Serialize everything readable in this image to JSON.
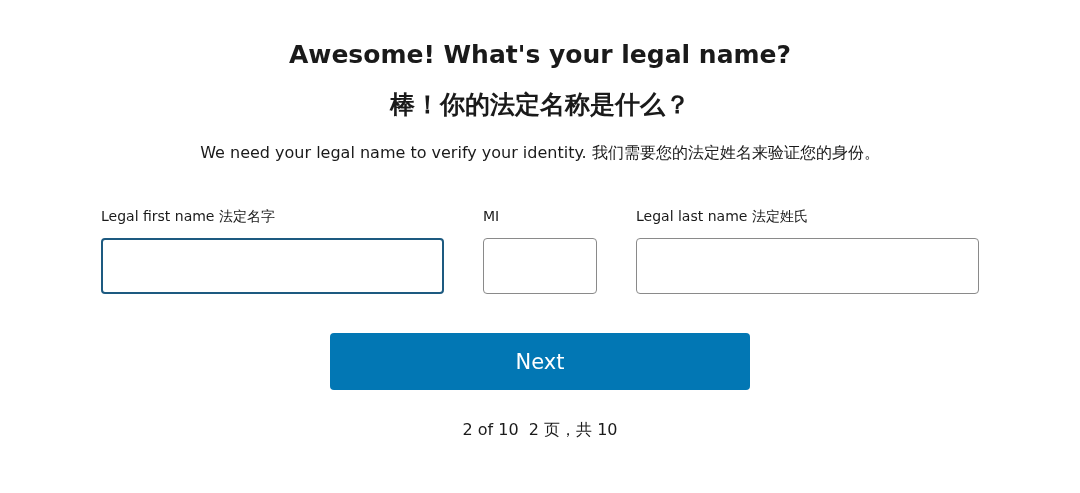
{
  "heading": "Awesome! What's your legal name?",
  "heading_translation": "棒！你的法定名称是什么？",
  "description": "We need your legal name to verify your identity. 我们需要您的法定姓名来验证您的身份。",
  "fields": [
    {
      "label": "Legal first name 法定名字",
      "kind": "name",
      "focused": true
    },
    {
      "label": "MI",
      "kind": "initial",
      "focused": false
    },
    {
      "label": "Legal last name 法定姓氏",
      "kind": "name",
      "focused": false
    }
  ],
  "next_button": "Next",
  "progress": "2 of 10  2 页，共 10"
}
